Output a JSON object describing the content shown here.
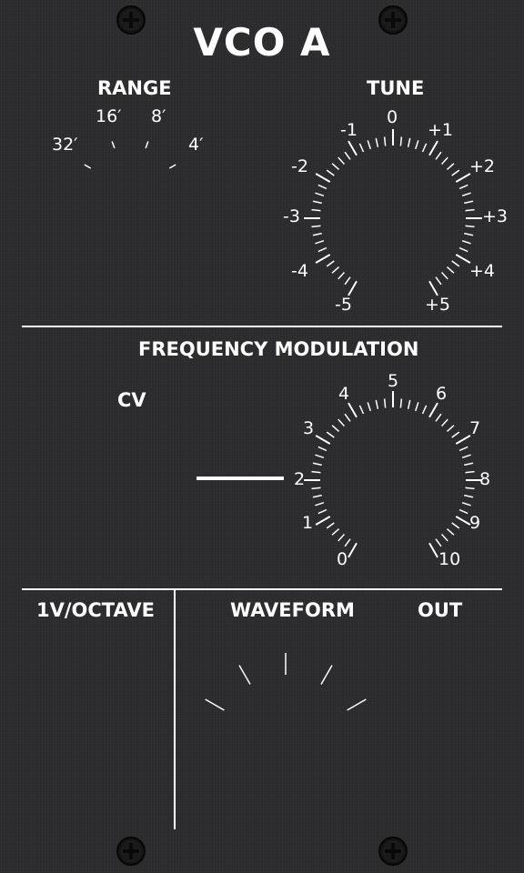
{
  "module": {
    "title": "VCO  A"
  },
  "range": {
    "label": "RANGE",
    "positions": [
      "32′",
      "16′",
      "8′",
      "4′"
    ]
  },
  "tune": {
    "label": "TUNE",
    "scale": [
      "-5",
      "-4",
      "-3",
      "-2",
      "-1",
      "0",
      "+1",
      "+2",
      "+3",
      "+4",
      "+5"
    ]
  },
  "fm": {
    "label": "FREQUENCY MODULATION",
    "cv_label": "CV",
    "scale": [
      "0",
      "1",
      "2",
      "3",
      "4",
      "5",
      "6",
      "7",
      "8",
      "9",
      "10"
    ]
  },
  "footer": {
    "octave_label": "1V/OCTAVE",
    "waveform_label": "WAVEFORM",
    "out_label": "OUT"
  },
  "colors": {
    "panel": "#2b2b2d",
    "print": "#ffffff",
    "screw": "#111111"
  },
  "icons": {
    "screw": "phillips-screw-icon"
  }
}
